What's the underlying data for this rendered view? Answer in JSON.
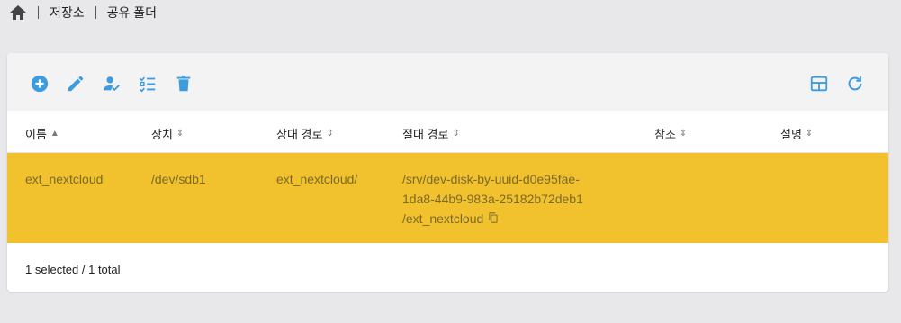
{
  "breadcrumb": {
    "home_icon": "home-icon",
    "items": [
      "저장소",
      "공유 폴더"
    ]
  },
  "toolbar": {
    "accent_color": "#3d9be0",
    "left_icons": [
      "add-circle-icon",
      "edit-pencil-icon",
      "user-permission-icon",
      "checklist-icon",
      "delete-trash-icon"
    ],
    "right_icons": [
      "columns-grid-icon",
      "refresh-icon"
    ]
  },
  "table": {
    "columns": [
      {
        "label": "이름",
        "sort": "▲"
      },
      {
        "label": "장치",
        "sort": "⇕"
      },
      {
        "label": "상대 경로",
        "sort": "⇕"
      },
      {
        "label": "절대 경로",
        "sort": "⇕"
      },
      {
        "label": "참조",
        "sort": "⇕"
      },
      {
        "label": "설명",
        "sort": "⇕"
      }
    ],
    "rows": [
      {
        "name": "ext_nextcloud",
        "device": "/dev/sdb1",
        "relative_path": "ext_nextcloud/",
        "absolute_path_lines": [
          "/srv/dev-disk-by-uuid-d0e95fae-",
          "1da8-44b9-983a-25182b72deb1",
          "/ext_nextcloud"
        ],
        "reference": "",
        "description": "",
        "selected": true,
        "highlight_color": "#f2c12e"
      }
    ]
  },
  "footer": {
    "status": "1 selected / 1 total"
  }
}
